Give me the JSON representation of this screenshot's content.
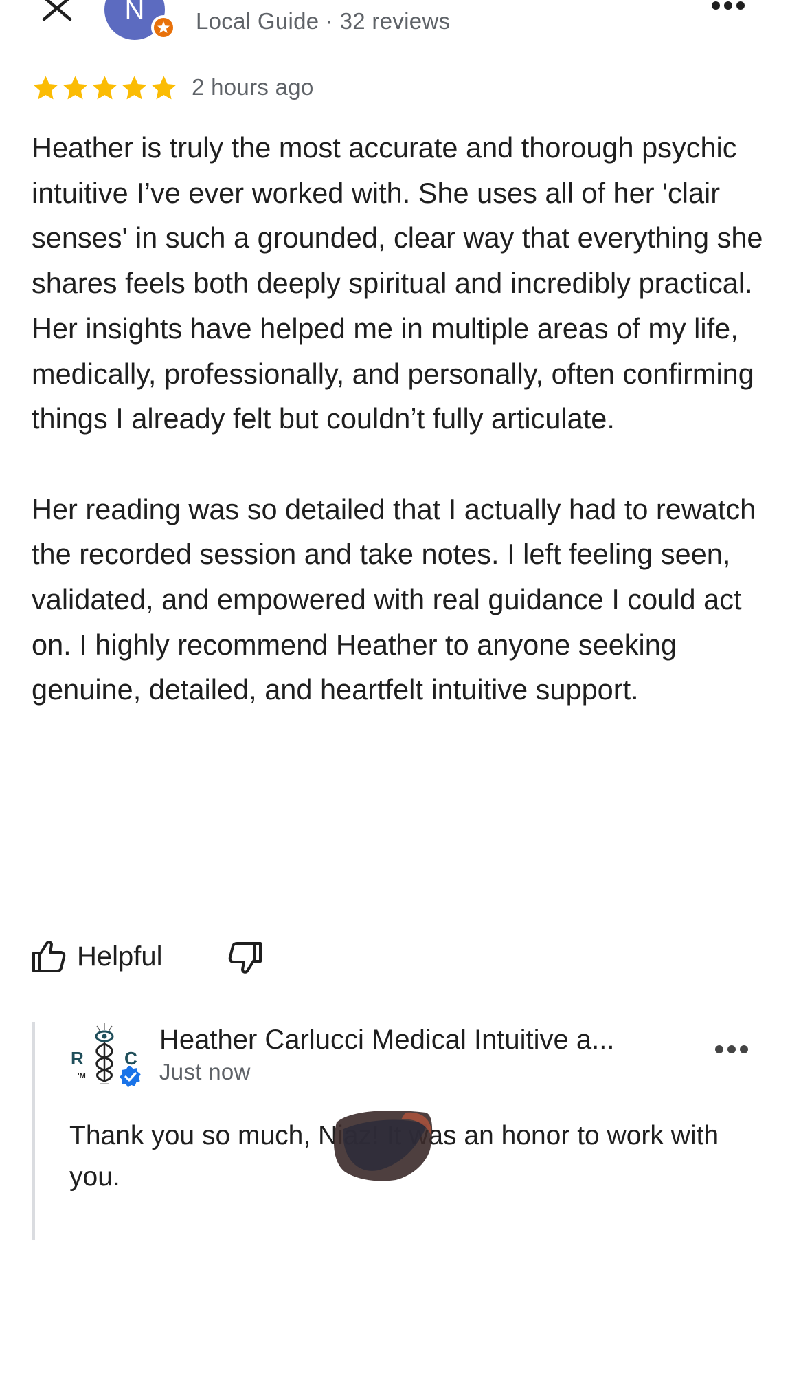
{
  "header": {
    "close_icon": "close-icon",
    "more_icon": "more-options-icon"
  },
  "reviewer": {
    "avatar_initial": "N",
    "badge_icon": "local-guide-star-icon",
    "meta": "Local Guide · 32 reviews"
  },
  "review": {
    "rating": 5,
    "max_rating": 5,
    "star_color": "#fbbc04",
    "time": "2 hours ago",
    "paragraphs": [
      "Heather is truly the most accurate and thorough psychic intuitive I’ve ever worked with. She uses all of her 'clair senses' in such a grounded, clear way that everything she shares feels both deeply spiritual and incredibly practical. Her insights have helped me in multiple areas of my life, medically, professionally, and personally, often confirming things I already felt but couldn’t fully articulate.",
      "Her reading was so detailed that I actually had to rewatch the recorded session and take notes. I left feeling seen, validated, and empowered with real guidance I could act on. I highly recommend Heather to anyone seeking genuine, detailed, and heartfelt intuitive support."
    ]
  },
  "actions": {
    "helpful_label": "Helpful",
    "helpful_icon": "thumbs-up-icon",
    "dislike_icon": "thumbs-down-icon"
  },
  "owner_response": {
    "name": "Heather Carlucci Medical Intuitive a...",
    "time": "Just now",
    "text": "Thank you so much, Niaz! It was an honor to work with you.",
    "logo_icon": "business-logo-icon",
    "verified_icon": "verified-badge-icon",
    "verified_color": "#1a73e8",
    "more_icon": "more-options-icon"
  }
}
